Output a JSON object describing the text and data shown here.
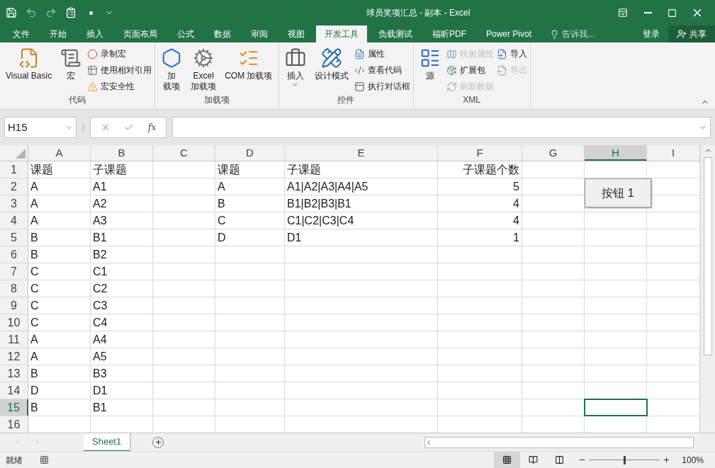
{
  "window": {
    "title": "球员奖项汇总 - 副本 - Excel"
  },
  "ribbon_tabs": [
    {
      "label": "文件",
      "selected": false
    },
    {
      "label": "开始",
      "selected": false
    },
    {
      "label": "插入",
      "selected": false
    },
    {
      "label": "页面布局",
      "selected": false
    },
    {
      "label": "公式",
      "selected": false
    },
    {
      "label": "数据",
      "selected": false
    },
    {
      "label": "审阅",
      "selected": false
    },
    {
      "label": "视图",
      "selected": false
    },
    {
      "label": "开发工具",
      "selected": true
    },
    {
      "label": "负载测试",
      "selected": false
    },
    {
      "label": "福昕PDF",
      "selected": false
    },
    {
      "label": "Power Pivot",
      "selected": false
    }
  ],
  "tell_me": {
    "placeholder": "告诉我..."
  },
  "sign_in": "登录",
  "share": "共享",
  "ribbon_groups": [
    {
      "label": "代码",
      "items": [
        {
          "kind": "large",
          "lines": [
            "Visual Basic"
          ],
          "disabled": false
        },
        {
          "kind": "large",
          "lines": [
            "宏"
          ],
          "disabled": false
        },
        {
          "kind": "stack",
          "items": [
            {
              "label": "录制宏",
              "disabled": false
            },
            {
              "label": "使用相对引用",
              "disabled": false
            },
            {
              "label": "宏安全性",
              "disabled": false
            }
          ]
        }
      ]
    },
    {
      "label": "加载项",
      "items": [
        {
          "kind": "large",
          "lines": [
            "加",
            "载项"
          ],
          "disabled": false
        },
        {
          "kind": "large",
          "lines": [
            "Excel",
            "加载项"
          ],
          "disabled": false
        },
        {
          "kind": "large",
          "lines": [
            "COM 加载项"
          ],
          "disabled": false
        }
      ]
    },
    {
      "label": "控件",
      "items": [
        {
          "kind": "large",
          "lines": [
            "插入"
          ],
          "dropdown": true,
          "disabled": false
        },
        {
          "kind": "large",
          "lines": [
            "设计模式"
          ],
          "disabled": false
        },
        {
          "kind": "stack",
          "items": [
            {
              "label": "属性",
              "disabled": false
            },
            {
              "label": "查看代码",
              "disabled": false
            },
            {
              "label": "执行对话框",
              "disabled": false
            }
          ]
        }
      ]
    },
    {
      "label": "XML",
      "items": [
        {
          "kind": "large",
          "lines": [
            "源"
          ],
          "disabled": false
        },
        {
          "kind": "stack",
          "items": [
            {
              "label": "映射属性",
              "disabled": true
            },
            {
              "label": "扩展包",
              "disabled": false
            },
            {
              "label": "刷新数据",
              "disabled": true
            }
          ]
        },
        {
          "kind": "stack",
          "items": [
            {
              "label": "导入",
              "disabled": false
            },
            {
              "label": "导出",
              "disabled": true
            }
          ]
        }
      ]
    }
  ],
  "formula_bar": {
    "name_box": "H15",
    "function_label": "fx"
  },
  "columns": [
    {
      "label": "A",
      "kind": "text",
      "selected": false
    },
    {
      "label": "B",
      "kind": "text",
      "selected": false
    },
    {
      "label": "C",
      "kind": "text",
      "selected": false
    },
    {
      "label": "D",
      "kind": "text",
      "selected": false
    },
    {
      "label": "E",
      "kind": "text",
      "selected": false
    },
    {
      "label": "F",
      "kind": "number",
      "selected": false
    },
    {
      "label": "G",
      "kind": "text",
      "selected": false
    },
    {
      "label": "H",
      "kind": "text",
      "selected": true
    },
    {
      "label": "I",
      "kind": "text",
      "selected": false
    }
  ],
  "rows": [
    {
      "header": "1",
      "selected": false,
      "cells": [
        "课题",
        "子课题",
        "",
        "课题",
        "子课题",
        "子课题个数",
        "",
        "",
        ""
      ]
    },
    {
      "header": "2",
      "selected": false,
      "cells": [
        "A",
        "A1",
        "",
        "A",
        "A1|A2|A3|A4|A5",
        "5",
        "",
        "",
        ""
      ]
    },
    {
      "header": "3",
      "selected": false,
      "cells": [
        "A",
        "A2",
        "",
        "B",
        "B1|B2|B3|B1",
        "4",
        "",
        "",
        ""
      ]
    },
    {
      "header": "4",
      "selected": false,
      "cells": [
        "A",
        "A3",
        "",
        "C",
        "C1|C2|C3|C4",
        "4",
        "",
        "",
        ""
      ]
    },
    {
      "header": "5",
      "selected": false,
      "cells": [
        "B",
        "B1",
        "",
        "D",
        "D1",
        "1",
        "",
        "",
        ""
      ]
    },
    {
      "header": "6",
      "selected": false,
      "cells": [
        "B",
        "B2",
        "",
        "",
        "",
        "",
        "",
        "",
        ""
      ]
    },
    {
      "header": "7",
      "selected": false,
      "cells": [
        "C",
        "C1",
        "",
        "",
        "",
        "",
        "",
        "",
        ""
      ]
    },
    {
      "header": "8",
      "selected": false,
      "cells": [
        "C",
        "C2",
        "",
        "",
        "",
        "",
        "",
        "",
        ""
      ]
    },
    {
      "header": "9",
      "selected": false,
      "cells": [
        "C",
        "C3",
        "",
        "",
        "",
        "",
        "",
        "",
        ""
      ]
    },
    {
      "header": "10",
      "selected": false,
      "cells": [
        "C",
        "C4",
        "",
        "",
        "",
        "",
        "",
        "",
        ""
      ]
    },
    {
      "header": "11",
      "selected": false,
      "cells": [
        "A",
        "A4",
        "",
        "",
        "",
        "",
        "",
        "",
        ""
      ]
    },
    {
      "header": "12",
      "selected": false,
      "cells": [
        "A",
        "A5",
        "",
        "",
        "",
        "",
        "",
        "",
        ""
      ]
    },
    {
      "header": "13",
      "selected": false,
      "cells": [
        "B",
        "B3",
        "",
        "",
        "",
        "",
        "",
        "",
        ""
      ]
    },
    {
      "header": "14",
      "selected": false,
      "cells": [
        "D",
        "D1",
        "",
        "",
        "",
        "",
        "",
        "",
        ""
      ]
    },
    {
      "header": "15",
      "selected": true,
      "cells": [
        "B",
        "B1",
        "",
        "",
        "",
        "",
        "",
        "",
        ""
      ]
    },
    {
      "header": "16",
      "selected": false,
      "cells": [
        "",
        "",
        "",
        "",
        "",
        "",
        "",
        "",
        ""
      ]
    }
  ],
  "form_button": {
    "label": "按钮 1"
  },
  "sheet_tabs": [
    {
      "label": "Sheet1",
      "selected": true
    }
  ],
  "status_bar": {
    "text": "就绪",
    "zoom": {
      "level": 0.5,
      "reading": "100%"
    }
  }
}
